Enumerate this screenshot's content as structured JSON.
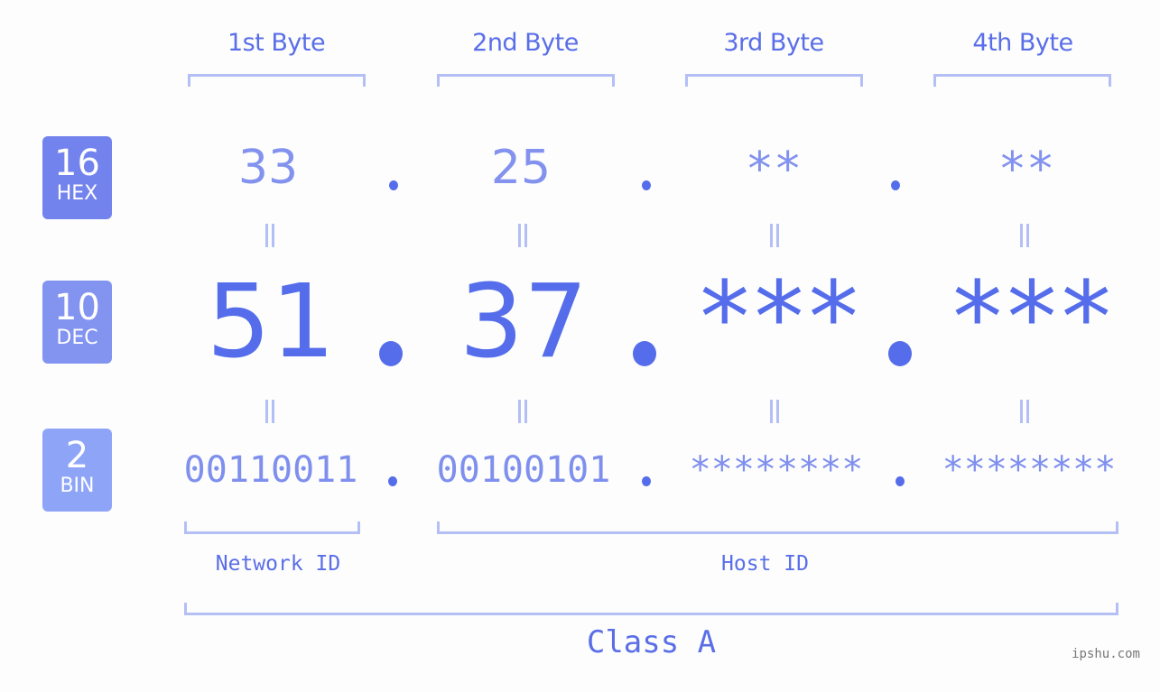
{
  "bytes": {
    "headers": [
      "1st Byte",
      "2nd Byte",
      "3rd Byte",
      "4th Byte"
    ]
  },
  "bases": {
    "hex": {
      "number": "16",
      "label": "HEX",
      "color": "#7383ed"
    },
    "dec": {
      "number": "10",
      "label": "DEC",
      "color": "#8293f0"
    },
    "bin": {
      "number": "2",
      "label": "BIN",
      "color": "#8ea5f7"
    }
  },
  "address": {
    "hex": [
      "33",
      "25",
      "**",
      "**"
    ],
    "dec": [
      "51",
      "37",
      "***",
      "***"
    ],
    "bin": [
      "00110011",
      "00100101",
      "********",
      "********"
    ],
    "separator": "."
  },
  "segments": {
    "network_label": "Network ID",
    "host_label": "Host ID",
    "class_label": "Class A"
  },
  "colors": {
    "primary": "#556deb",
    "light": "#8292ee",
    "bracket": "#b4bff6",
    "background": "#fcfdfc"
  },
  "watermark": "ipshu.com"
}
